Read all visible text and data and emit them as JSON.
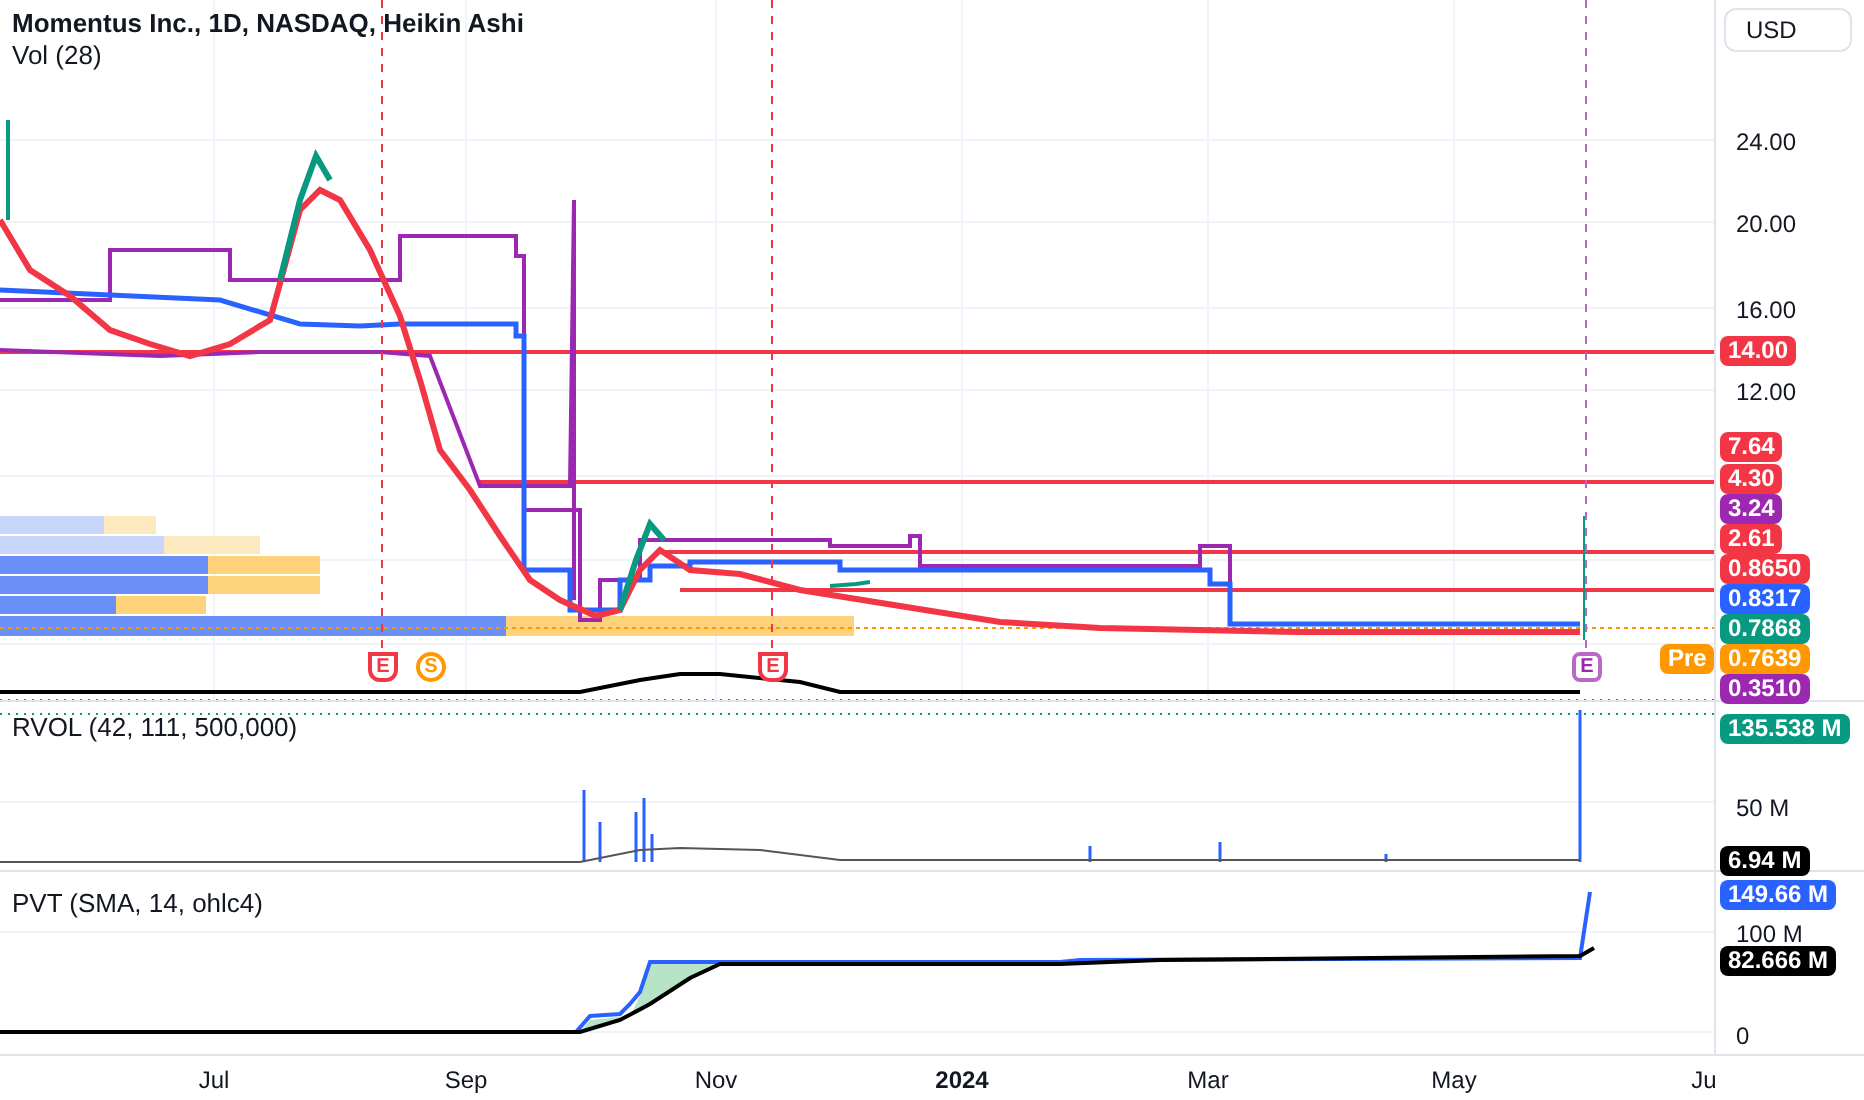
{
  "header": {
    "title": "Momentus Inc., 1D, NASDAQ, Heikin Ashi",
    "volume_label": "Vol (28)"
  },
  "currency": "USD",
  "price_axis": {
    "ticks": [
      "24.00",
      "20.00",
      "16.00",
      "12.00"
    ],
    "labels": [
      {
        "text": "14.00",
        "color": "#f23645"
      },
      {
        "text": "7.64",
        "color": "#f23645"
      },
      {
        "text": "4.30",
        "color": "#f23645"
      },
      {
        "text": "3.24",
        "color": "#9c27b0"
      },
      {
        "text": "2.61",
        "color": "#f23645"
      },
      {
        "text": "0.8650",
        "color": "#f23645"
      },
      {
        "text": "0.8317",
        "color": "#2962ff"
      },
      {
        "text": "0.7868",
        "color": "#089981"
      },
      {
        "text": "0.7639",
        "color": "#ff9800",
        "tag": "Pre"
      },
      {
        "text": "0.3510",
        "color": "#9c27b0"
      }
    ]
  },
  "events": [
    {
      "kind": "earnings",
      "text": "E"
    },
    {
      "kind": "split",
      "text": "S"
    },
    {
      "kind": "earnings",
      "text": "E"
    },
    {
      "kind": "earnings-next",
      "text": "E"
    }
  ],
  "rvol": {
    "title": "RVOL (42, 111, 500,000)",
    "ticks": [
      "50 M"
    ],
    "labels": [
      {
        "text": "135.538 M",
        "color": "#089981"
      },
      {
        "text": "6.94 M",
        "color": "#000000"
      }
    ]
  },
  "pvt": {
    "title": "PVT (SMA, 14, ohlc4)",
    "ticks": [
      "100 M",
      "0"
    ],
    "labels": [
      {
        "text": "149.66 M",
        "color": "#2962ff"
      },
      {
        "text": "82.666 M",
        "color": "#000000"
      }
    ]
  },
  "time_axis": [
    {
      "text": "Jul",
      "bold": false
    },
    {
      "text": "Sep",
      "bold": false
    },
    {
      "text": "Nov",
      "bold": false
    },
    {
      "text": "2024",
      "bold": true
    },
    {
      "text": "Mar",
      "bold": false
    },
    {
      "text": "May",
      "bold": false
    },
    {
      "text": "Ju",
      "bold": false
    }
  ]
}
